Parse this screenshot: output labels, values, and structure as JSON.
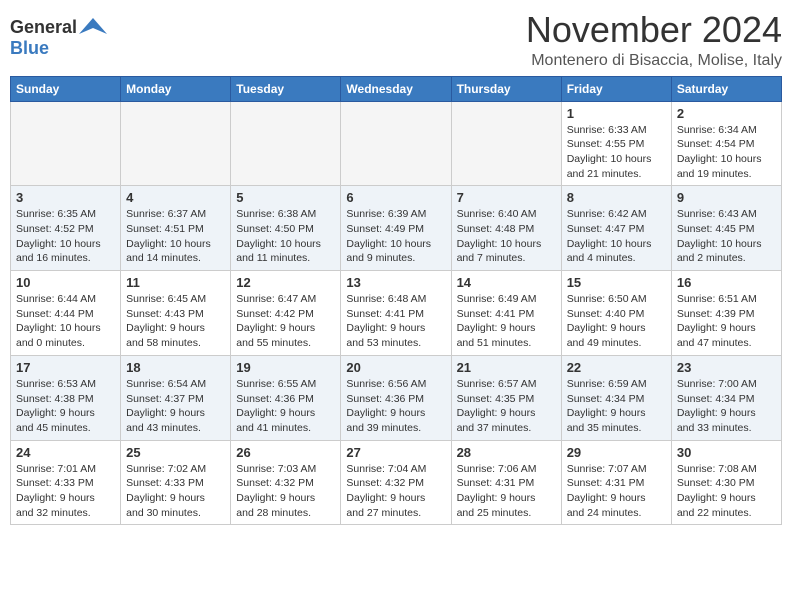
{
  "header": {
    "logo_general": "General",
    "logo_blue": "Blue",
    "month": "November 2024",
    "location": "Montenero di Bisaccia, Molise, Italy"
  },
  "weekdays": [
    "Sunday",
    "Monday",
    "Tuesday",
    "Wednesday",
    "Thursday",
    "Friday",
    "Saturday"
  ],
  "weeks": [
    [
      {
        "day": "",
        "info": ""
      },
      {
        "day": "",
        "info": ""
      },
      {
        "day": "",
        "info": ""
      },
      {
        "day": "",
        "info": ""
      },
      {
        "day": "",
        "info": ""
      },
      {
        "day": "1",
        "info": "Sunrise: 6:33 AM\nSunset: 4:55 PM\nDaylight: 10 hours\nand 21 minutes."
      },
      {
        "day": "2",
        "info": "Sunrise: 6:34 AM\nSunset: 4:54 PM\nDaylight: 10 hours\nand 19 minutes."
      }
    ],
    [
      {
        "day": "3",
        "info": "Sunrise: 6:35 AM\nSunset: 4:52 PM\nDaylight: 10 hours\nand 16 minutes."
      },
      {
        "day": "4",
        "info": "Sunrise: 6:37 AM\nSunset: 4:51 PM\nDaylight: 10 hours\nand 14 minutes."
      },
      {
        "day": "5",
        "info": "Sunrise: 6:38 AM\nSunset: 4:50 PM\nDaylight: 10 hours\nand 11 minutes."
      },
      {
        "day": "6",
        "info": "Sunrise: 6:39 AM\nSunset: 4:49 PM\nDaylight: 10 hours\nand 9 minutes."
      },
      {
        "day": "7",
        "info": "Sunrise: 6:40 AM\nSunset: 4:48 PM\nDaylight: 10 hours\nand 7 minutes."
      },
      {
        "day": "8",
        "info": "Sunrise: 6:42 AM\nSunset: 4:47 PM\nDaylight: 10 hours\nand 4 minutes."
      },
      {
        "day": "9",
        "info": "Sunrise: 6:43 AM\nSunset: 4:45 PM\nDaylight: 10 hours\nand 2 minutes."
      }
    ],
    [
      {
        "day": "10",
        "info": "Sunrise: 6:44 AM\nSunset: 4:44 PM\nDaylight: 10 hours\nand 0 minutes."
      },
      {
        "day": "11",
        "info": "Sunrise: 6:45 AM\nSunset: 4:43 PM\nDaylight: 9 hours\nand 58 minutes."
      },
      {
        "day": "12",
        "info": "Sunrise: 6:47 AM\nSunset: 4:42 PM\nDaylight: 9 hours\nand 55 minutes."
      },
      {
        "day": "13",
        "info": "Sunrise: 6:48 AM\nSunset: 4:41 PM\nDaylight: 9 hours\nand 53 minutes."
      },
      {
        "day": "14",
        "info": "Sunrise: 6:49 AM\nSunset: 4:41 PM\nDaylight: 9 hours\nand 51 minutes."
      },
      {
        "day": "15",
        "info": "Sunrise: 6:50 AM\nSunset: 4:40 PM\nDaylight: 9 hours\nand 49 minutes."
      },
      {
        "day": "16",
        "info": "Sunrise: 6:51 AM\nSunset: 4:39 PM\nDaylight: 9 hours\nand 47 minutes."
      }
    ],
    [
      {
        "day": "17",
        "info": "Sunrise: 6:53 AM\nSunset: 4:38 PM\nDaylight: 9 hours\nand 45 minutes."
      },
      {
        "day": "18",
        "info": "Sunrise: 6:54 AM\nSunset: 4:37 PM\nDaylight: 9 hours\nand 43 minutes."
      },
      {
        "day": "19",
        "info": "Sunrise: 6:55 AM\nSunset: 4:36 PM\nDaylight: 9 hours\nand 41 minutes."
      },
      {
        "day": "20",
        "info": "Sunrise: 6:56 AM\nSunset: 4:36 PM\nDaylight: 9 hours\nand 39 minutes."
      },
      {
        "day": "21",
        "info": "Sunrise: 6:57 AM\nSunset: 4:35 PM\nDaylight: 9 hours\nand 37 minutes."
      },
      {
        "day": "22",
        "info": "Sunrise: 6:59 AM\nSunset: 4:34 PM\nDaylight: 9 hours\nand 35 minutes."
      },
      {
        "day": "23",
        "info": "Sunrise: 7:00 AM\nSunset: 4:34 PM\nDaylight: 9 hours\nand 33 minutes."
      }
    ],
    [
      {
        "day": "24",
        "info": "Sunrise: 7:01 AM\nSunset: 4:33 PM\nDaylight: 9 hours\nand 32 minutes."
      },
      {
        "day": "25",
        "info": "Sunrise: 7:02 AM\nSunset: 4:33 PM\nDaylight: 9 hours\nand 30 minutes."
      },
      {
        "day": "26",
        "info": "Sunrise: 7:03 AM\nSunset: 4:32 PM\nDaylight: 9 hours\nand 28 minutes."
      },
      {
        "day": "27",
        "info": "Sunrise: 7:04 AM\nSunset: 4:32 PM\nDaylight: 9 hours\nand 27 minutes."
      },
      {
        "day": "28",
        "info": "Sunrise: 7:06 AM\nSunset: 4:31 PM\nDaylight: 9 hours\nand 25 minutes."
      },
      {
        "day": "29",
        "info": "Sunrise: 7:07 AM\nSunset: 4:31 PM\nDaylight: 9 hours\nand 24 minutes."
      },
      {
        "day": "30",
        "info": "Sunrise: 7:08 AM\nSunset: 4:30 PM\nDaylight: 9 hours\nand 22 minutes."
      }
    ]
  ]
}
